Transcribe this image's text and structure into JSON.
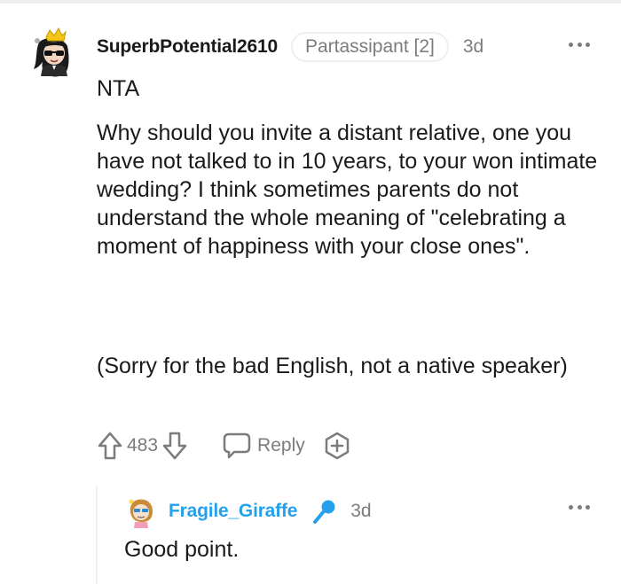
{
  "comment": {
    "author": "SuperbPotential2610",
    "flair": "Partassipant [2]",
    "time": "3d",
    "paragraphs": [
      "NTA",
      "Why should you invite a distant relative, one you have not talked to in 10 years, to your won intimate wedding? I think sometimes parents do not understand the whole meaning of \"celebrating a moment of happiness with your close ones\".",
      "(Sorry for the bad English, not a native speaker)"
    ],
    "score": "483",
    "reply_label": "Reply"
  },
  "reply": {
    "author": "Fragile_Giraffe",
    "time": "3d",
    "text": "Good point."
  },
  "icons": {
    "upvote": "upvote-arrow-icon",
    "downvote": "downvote-arrow-icon",
    "reply": "speech-bubble-icon",
    "award": "award-plus-icon",
    "more": "more-dots-icon",
    "author_badge": "microphone-icon"
  },
  "colors": {
    "text": "#1a1a1b",
    "meta": "#7c7c7c",
    "reply_username": "#24a0ed",
    "divider": "#edeff1"
  }
}
